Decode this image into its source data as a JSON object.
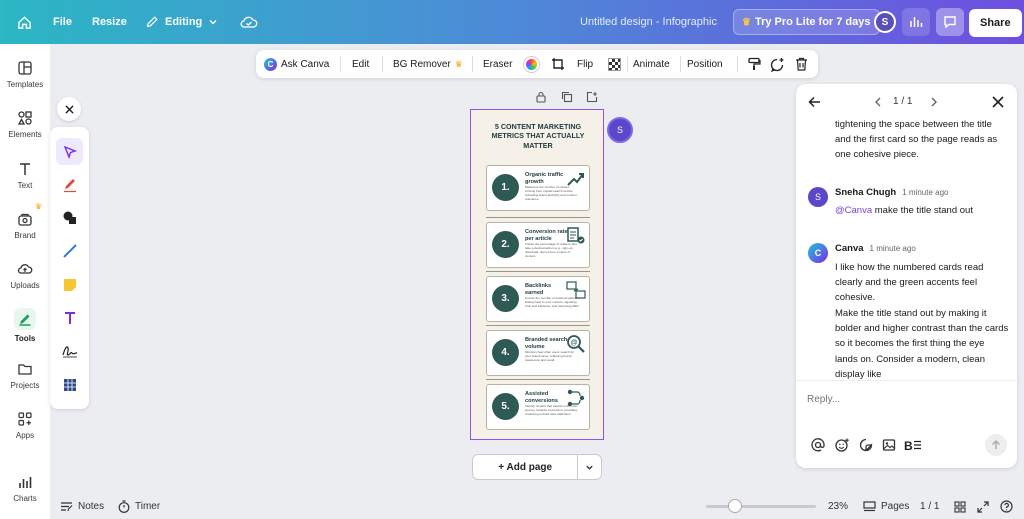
{
  "topbar": {
    "file": "File",
    "resize": "Resize",
    "editing": "Editing",
    "title": "Untitled design - Infographic",
    "pro": "Try Pro Lite for 7 days",
    "avatar": "S",
    "share": "Share"
  },
  "left_rail": [
    {
      "label": "Templates",
      "icon": "templates-icon"
    },
    {
      "label": "Elements",
      "icon": "elements-icon"
    },
    {
      "label": "Text",
      "icon": "text-icon"
    },
    {
      "label": "Brand",
      "icon": "brand-icon"
    },
    {
      "label": "Uploads",
      "icon": "uploads-icon"
    },
    {
      "label": "Tools",
      "icon": "tools-icon"
    },
    {
      "label": "Projects",
      "icon": "projects-icon"
    },
    {
      "label": "Apps",
      "icon": "apps-icon"
    },
    {
      "label": "Charts",
      "icon": "charts-icon"
    }
  ],
  "toolbar": {
    "ask_canva": "Ask Canva",
    "edit": "Edit",
    "bg_remover": "BG Remover",
    "eraser": "Eraser",
    "flip": "Flip",
    "animate": "Animate",
    "position": "Position"
  },
  "design": {
    "title": "5 CONTENT MARKETING METRICS THAT ACTUALLY MATTER",
    "cards": [
      {
        "num": "1.",
        "title": "Organic traffic growth",
        "body": "Measures the number of visitors arriving from unpaid search results, indicating brand authority and content relevance."
      },
      {
        "num": "2.",
        "title": "Conversion rate per article",
        "body": "Tracks the percentage of readers who take a desired action (e.g., sign-up, download, demo) from a piece of content."
      },
      {
        "num": "3.",
        "title": "Backlinks earned",
        "body": "Counts the number of external websites linking back to your content, signaling trust and influence, and improving SEO."
      },
      {
        "num": "4.",
        "title": "Branded search volume",
        "body": "Monitors how often users search for your brand name, reflecting brand awareness and recall."
      },
      {
        "num": "5.",
        "title": "Assisted conversions",
        "body": "Identify content that assists in the user journey towards conversion, providing credit beyond last click attribution."
      }
    ]
  },
  "collaborator": "S",
  "add_page": "+ Add page",
  "comments": {
    "pager": "1 / 1",
    "intro": "tightening the space between the title and the first card so the page reads as one cohesive piece.",
    "entries": [
      {
        "author": "Sneha Chugh",
        "time": "1 minute ago",
        "avatar": "S",
        "mention": "@Canva",
        "text": " make the title stand out"
      },
      {
        "author": "Canva",
        "time": "1 minute ago",
        "text1": "I like how the numbered cards read clearly and the green accents feel cohesive.",
        "text2": "Make the title stand out by making it bolder and higher contrast than the cards so it becomes the first thing the eye lands on. Consider a modern, clean display like"
      }
    ],
    "reply_placeholder": "Reply..."
  },
  "bottombar": {
    "notes": "Notes",
    "timer": "Timer",
    "zoom": "23%",
    "zoom_level": 0.23,
    "pages": "Pages",
    "page_count": "1 / 1"
  },
  "colors": {
    "accent": "#8c54e8",
    "card_green": "#2e5a55",
    "title_teal": "#1d3b3f"
  }
}
